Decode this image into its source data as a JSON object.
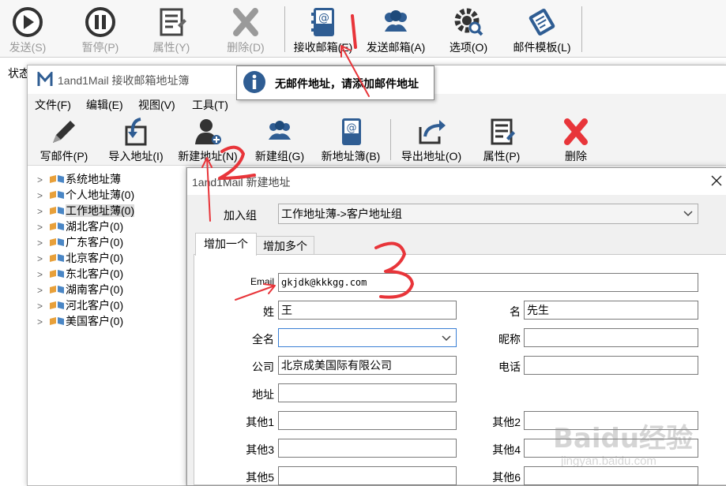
{
  "main_toolbar": {
    "send": "发送(S)",
    "pause": "暂停(P)",
    "properties": "属性(Y)",
    "delete": "删除(D)",
    "inbox": "接收邮箱(E)",
    "outbox": "发送邮箱(A)",
    "options": "选项(O)",
    "template": "邮件模板(L)"
  },
  "status_label": "状态",
  "tooltip": {
    "text": "无邮件地址，请添加邮件地址",
    "icon": "info-icon"
  },
  "addressbook": {
    "title": "1and1Mail 接收邮箱地址簿",
    "menu": [
      "文件(F)",
      "编辑(E)",
      "视图(V)",
      "工具(T)"
    ],
    "toolbar": {
      "write": "写邮件(P)",
      "import": "导入地址(I)",
      "new_address": "新建地址(N)",
      "new_group": "新建组(G)",
      "new_book": "新地址簿(B)",
      "export": "导出地址(O)",
      "properties": "属性(P)",
      "delete": "删除"
    },
    "tree": [
      "系统地址薄",
      "个人地址薄(0)",
      "工作地址薄(0)",
      "湖北客户(0)",
      "广东客户(0)",
      "北京客户(0)",
      "东北客户(0)",
      "湖南客户(0)",
      "河北客户(0)",
      "美国客户(0)"
    ]
  },
  "dialog": {
    "title": "1and1Mail 新建地址",
    "group_label": "加入组",
    "group_value": "工作地址薄->客户地址组",
    "tabs": [
      "增加一个",
      "增加多个"
    ],
    "email_label": "Email",
    "email_value": "gkjdk@kkkgg.com",
    "surname_label": "姓",
    "surname_value": "王",
    "given_label": "名",
    "given_value": "先生",
    "fullname_label": "全名",
    "fullname_value": "",
    "nickname_label": "昵称",
    "nickname_value": "",
    "company_label": "公司",
    "company_value": "北京成美国际有限公司",
    "phone_label": "电话",
    "phone_value": "",
    "address_label": "地址",
    "address_value": "",
    "other1_label": "其他1",
    "other2_label": "其他2",
    "other3_label": "其他3",
    "other4_label": "其他4",
    "other5_label": "其他5",
    "other6_label": "其他6"
  },
  "annotations": [
    "1",
    "2",
    "3"
  ],
  "watermark": {
    "brand": "Baidu经验",
    "url": "jingyan.baidu.com"
  },
  "colors": {
    "accent_red": "#e8353a",
    "icon_blue": "#2f5d93",
    "selection": "#dcdcdc"
  }
}
